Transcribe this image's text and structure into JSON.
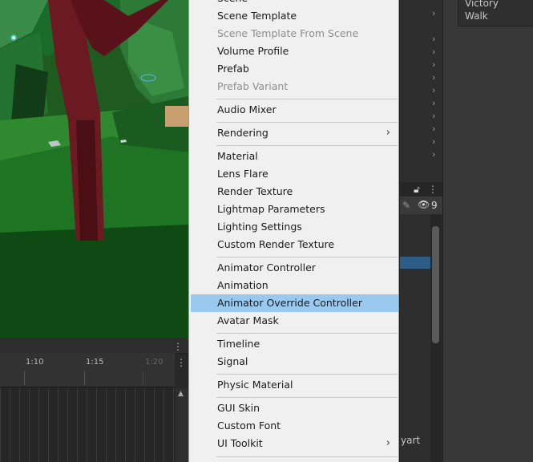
{
  "menu": {
    "items": [
      {
        "label": "Scene",
        "disabled": false
      },
      {
        "label": "Scene Template",
        "disabled": false
      },
      {
        "label": "Scene Template From Scene",
        "disabled": true
      },
      {
        "label": "Volume Profile",
        "disabled": false
      },
      {
        "label": "Prefab",
        "disabled": false
      },
      {
        "label": "Prefab Variant",
        "disabled": true
      },
      {
        "label": "Audio Mixer",
        "disabled": false
      },
      {
        "label": "Rendering",
        "submenu": true
      },
      {
        "label": "Material"
      },
      {
        "label": "Lens Flare"
      },
      {
        "label": "Render Texture"
      },
      {
        "label": "Lightmap Parameters"
      },
      {
        "label": "Lighting Settings"
      },
      {
        "label": "Custom Render Texture"
      },
      {
        "label": "Animator Controller"
      },
      {
        "label": "Animation"
      },
      {
        "label": "Animator Override Controller",
        "highlighted": true
      },
      {
        "label": "Avatar Mask"
      },
      {
        "label": "Timeline"
      },
      {
        "label": "Signal"
      },
      {
        "label": "Physic Material"
      },
      {
        "label": "GUI Skin"
      },
      {
        "label": "Custom Font"
      },
      {
        "label": "UI Toolkit",
        "submenu": true
      }
    ],
    "submenu_glyph": "›",
    "highlight_color": "#99c9ef"
  },
  "timeline": {
    "ticks": [
      "1:10",
      "1:15",
      "1:20"
    ]
  },
  "animation_list": {
    "items": [
      "Victory",
      "Walk"
    ]
  },
  "hierarchy": {
    "count_badge": "9",
    "partial_label": "yart"
  },
  "icons": {
    "lock": "lock-icon",
    "eye": "visibility-icon",
    "kebab": "more-options-icon",
    "chevron": "chevron-right-icon"
  }
}
